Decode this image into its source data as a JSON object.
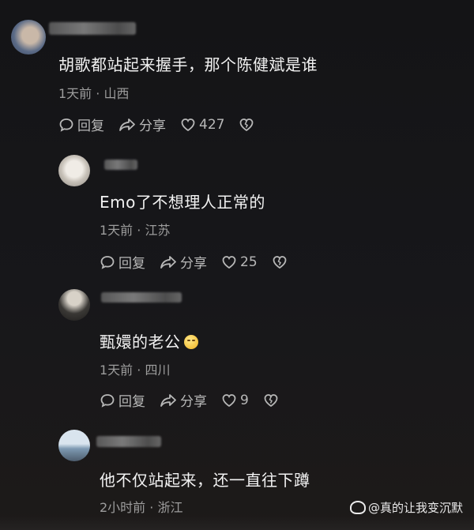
{
  "comments": [
    {
      "username": "用户",
      "text": "胡歌都站起来握手，那个陈健斌是谁",
      "time": "1天前",
      "location": "山西",
      "reply_label": "回复",
      "share_label": "分享",
      "likes": "427"
    },
    {
      "username": "用户",
      "text": "Emo了不想理人正常的",
      "time": "1天前",
      "location": "江苏",
      "reply_label": "回复",
      "share_label": "分享",
      "likes": "25"
    },
    {
      "username": "用户",
      "text": "甄嬛的老公",
      "emoji": "grin-emoji",
      "time": "1天前",
      "location": "四川",
      "reply_label": "回复",
      "share_label": "分享",
      "likes": "9"
    },
    {
      "username": "用户",
      "text": "他不仅站起来，还一直往下蹲",
      "time": "2小时前",
      "location": "浙江"
    }
  ],
  "separator": "·",
  "watermark": "@真的让我变沉默",
  "icons": {
    "reply": "comment-bubble-icon",
    "share": "share-arrow-icon",
    "like": "heart-icon",
    "dislike": "broken-heart-icon",
    "watermark": "weibo-logo-icon"
  }
}
